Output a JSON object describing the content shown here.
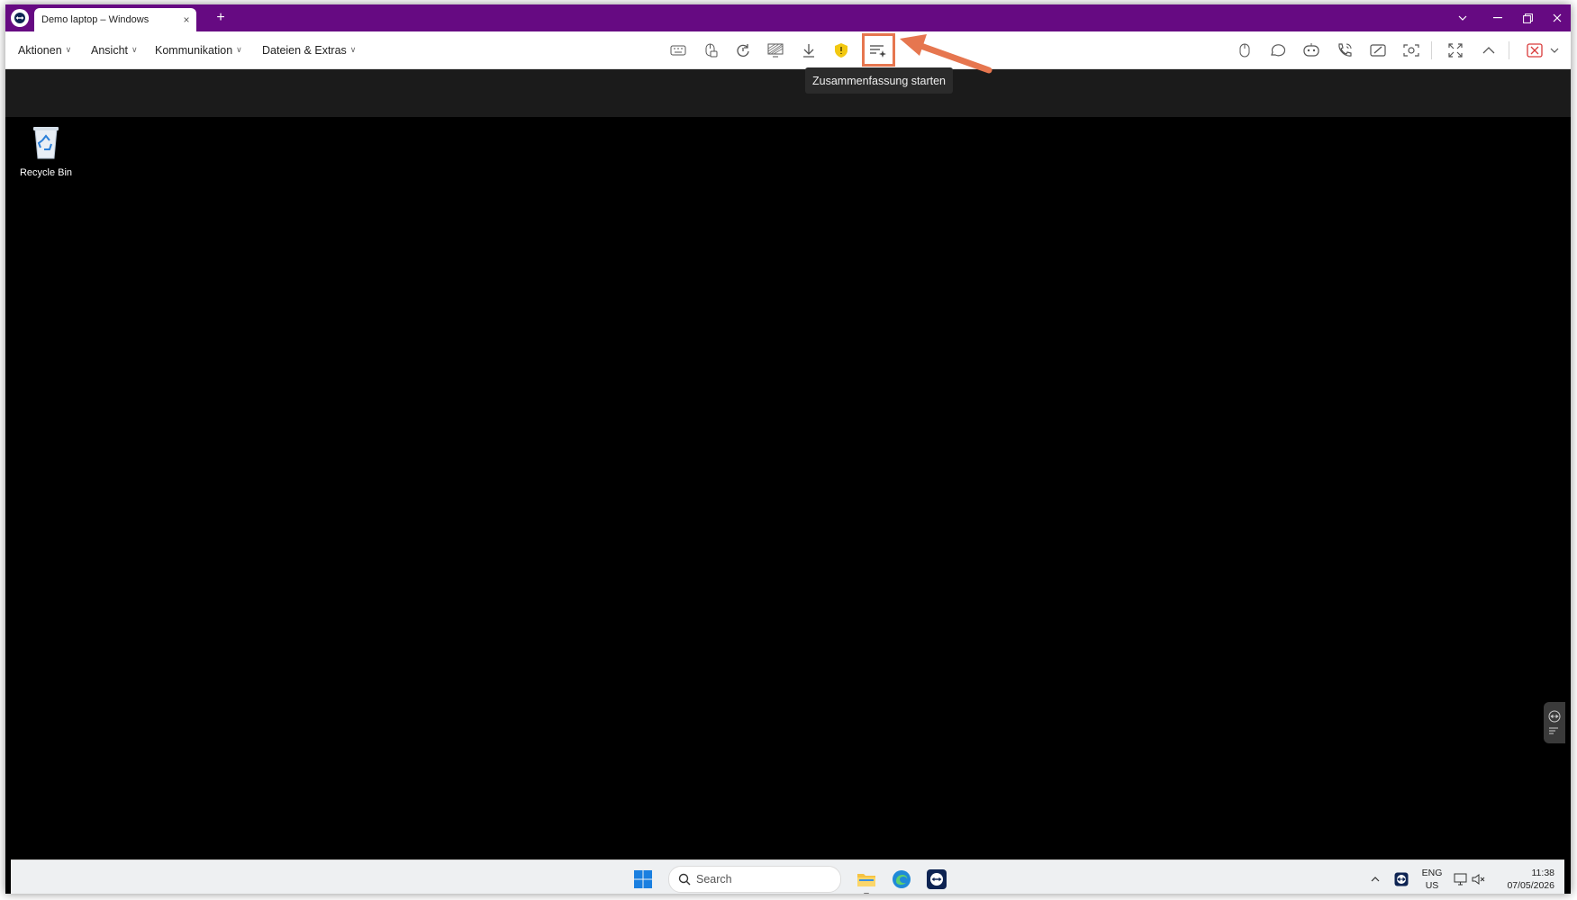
{
  "tab": {
    "title": "Demo laptop – Windows",
    "close_glyph": "×",
    "new_tab_glyph": "+"
  },
  "menus": [
    {
      "label": "Aktionen"
    },
    {
      "label": "Ansicht"
    },
    {
      "label": "Kommunikation"
    },
    {
      "label": "Dateien & Extras"
    }
  ],
  "toolbar_center_icons": [
    "remote-keyboard-icon",
    "mouse-lock-icon",
    "reboot-icon",
    "hide-wallpaper-icon",
    "download-icon",
    "security-shield-icon",
    "summary-icon"
  ],
  "toolbar_right_icons": [
    "user-icon",
    "chat-icon",
    "ai-assistant-icon",
    "call-icon",
    "whiteboard-icon",
    "screenshot-icon",
    "fullscreen-icon",
    "collapse-toolbar-icon",
    "end-session-icon"
  ],
  "tooltip": {
    "text": "Zusammenfassung starten"
  },
  "desktop": {
    "icon_label": "Recycle Bin"
  },
  "taskbar": {
    "search_placeholder": "Search",
    "lang_line1": "ENG",
    "lang_line2": "US",
    "time": "11:38",
    "date": "07/05/2026"
  },
  "colors": {
    "titlebar": "#660a82",
    "highlight": "#e6764f",
    "shield": "#f2c811"
  }
}
